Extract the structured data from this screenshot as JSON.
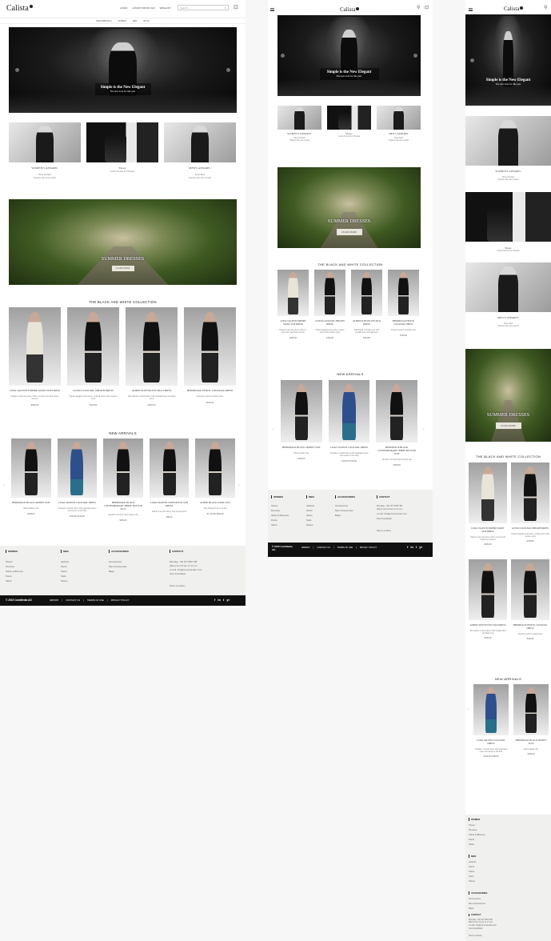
{
  "brand": "Calista",
  "nav": {
    "links": [
      "LOGIN",
      "LATEST FROM CGN",
      "WISHLIST"
    ],
    "search_placeholder": "Search..."
  },
  "categories": [
    "NEW ARRIVALS",
    "WOMEN",
    "MEN",
    "BLOG"
  ],
  "hero": {
    "title": "Simple is the New Elegant",
    "subtitle": "The new look for this year"
  },
  "tiles": [
    {
      "title": "WOMEN'S APPAREL",
      "l1": "Shop Women",
      "l2": "Explore the new trends"
    },
    {
      "title": "Shoes",
      "l1": "Latest Trends for Women",
      "l2": ""
    },
    {
      "title": "MEN'S APPAREL",
      "l1": "Shop Men",
      "l2": "Explore the new trends"
    }
  ],
  "banner": {
    "title": "SUMMER DRESSES",
    "button": "LEARN MORE"
  },
  "bw": {
    "title": "THE BLACK AND WHITE COLLECTION",
    "items": [
      {
        "name": "LUIGI VALENTI EMPIRE WAIST SLIP DRESS",
        "desc": "Empire waist slip dress with a V-neck and long flared sleeves",
        "price": "$299.00"
      },
      {
        "name": "GUSSO COCKTAIL SHEATH DRESS",
        "desc": "Figure-hugging sleeveless cocktail dress with couture waist",
        "price": "$199.00"
      },
      {
        "name": "ALBINI SLEEVELESS SILK DRESS",
        "desc": "Silk sheath cocktail dress with straight lines and high neck",
        "price": "$329.00"
      },
      {
        "name": "HERMITAGE PENCIL COCKTAIL DRESS",
        "desc": "Strapless pencil evening dress",
        "price": "$199.00"
      }
    ]
  },
  "arrivals": {
    "title": "NEW ARRIVALS",
    "items": [
      {
        "name": "HERMITAGE BLACK SKINNY SUIT",
        "desc": "Black skinny suit",
        "price": "$299.00"
      },
      {
        "name": "LUIGI VALENTI COCKTAIL DRESS",
        "desc": "Strapless cocktail dress with appliqued roses and tassels at the hem",
        "price": "$229.00 $199.00"
      },
      {
        "name": "HERMITAGE BLACK CONTEMPORARY THREE BUTTON SUIT",
        "desc": "Modern cut black three button suit",
        "price": "$299.00"
      },
      {
        "name": "LUIGI VALENTI SLEEVELESS SLIP DRESS",
        "desc": "Italian V-necked dress with layered skirt",
        "price": "$90.00"
      },
      {
        "name": "ALBINI BLACK WOOL SUIT",
        "desc": "Fine fitting black wool suit",
        "price": "$1,350.00 $999.00"
      }
    ]
  },
  "footer": {
    "cols": [
      {
        "title": "WOMEN",
        "items": [
          "Shoes",
          "Dresses",
          "Shirts & Blouses",
          "Pants",
          "Skirts"
        ]
      },
      {
        "title": "MEN",
        "items": [
          "Jackets",
          "Pants",
          "Shirts",
          "Suits",
          "Shoes"
        ]
      },
      {
        "title": "ACCESSORIES",
        "items": [
          "Accessories",
          "Men Accessories",
          "Bags"
        ]
      },
      {
        "title": "CONTACT",
        "items": [
          "Monday - 08 727 6507 88",
          "(8am) from 8 am to 17 pm",
          "e-mail: info@commstudio.com",
          "Give Feedback",
          "",
          "Store Location"
        ]
      }
    ],
    "copyright": "© 2015 ComMedia AG",
    "bottom_links": [
      "IMPRINT",
      "CONTACT US",
      "TERMS OF USE",
      "PRIVACY POLICY"
    ],
    "social": [
      "f",
      "in",
      "t",
      "yt"
    ]
  }
}
